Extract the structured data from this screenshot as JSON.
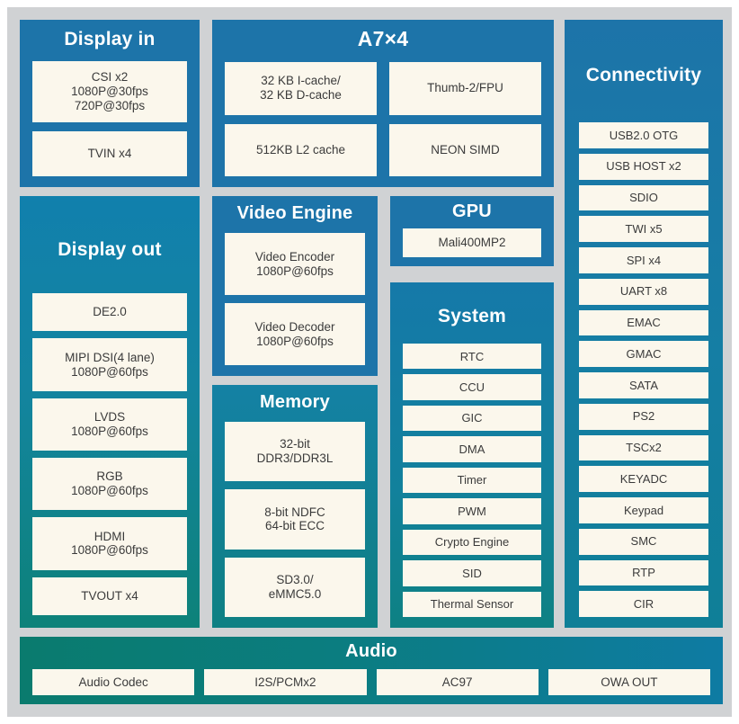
{
  "diagram": {
    "background_color": "#d0d2d4",
    "card_color": "#fbf7ec",
    "blue": "#1d74a9",
    "teal": "#0d8279",
    "green": "#0a7b6e"
  },
  "display_in": {
    "title": "Display in",
    "cards": [
      {
        "lines": [
          "CSI x2",
          "1080P@30fps",
          "720P@30fps"
        ]
      },
      {
        "lines": [
          "TVIN x4"
        ]
      }
    ]
  },
  "a7": {
    "title": "A7×4",
    "cards": [
      {
        "lines": [
          "32 KB I-cache/",
          "32 KB D-cache"
        ]
      },
      {
        "lines": [
          "Thumb-2/FPU"
        ]
      },
      {
        "lines": [
          "512KB L2 cache"
        ]
      },
      {
        "lines": [
          "NEON SIMD"
        ]
      }
    ]
  },
  "connectivity": {
    "title": "Connectivity",
    "cards": [
      {
        "lines": [
          "USB2.0 OTG"
        ]
      },
      {
        "lines": [
          "USB HOST x2"
        ]
      },
      {
        "lines": [
          "SDIO"
        ]
      },
      {
        "lines": [
          "TWI x5"
        ]
      },
      {
        "lines": [
          "SPI x4"
        ]
      },
      {
        "lines": [
          "UART x8"
        ]
      },
      {
        "lines": [
          "EMAC"
        ]
      },
      {
        "lines": [
          "GMAC"
        ]
      },
      {
        "lines": [
          "SATA"
        ]
      },
      {
        "lines": [
          "PS2"
        ]
      },
      {
        "lines": [
          "TSCx2"
        ]
      },
      {
        "lines": [
          "KEYADC"
        ]
      },
      {
        "lines": [
          "Keypad"
        ]
      },
      {
        "lines": [
          "SMC"
        ]
      },
      {
        "lines": [
          "RTP"
        ]
      },
      {
        "lines": [
          "CIR"
        ]
      }
    ]
  },
  "display_out": {
    "title": "Display out",
    "cards": [
      {
        "lines": [
          "DE2.0"
        ]
      },
      {
        "lines": [
          "MIPI DSI(4 lane)",
          "1080P@60fps"
        ]
      },
      {
        "lines": [
          "LVDS",
          "1080P@60fps"
        ]
      },
      {
        "lines": [
          "RGB",
          "1080P@60fps"
        ]
      },
      {
        "lines": [
          "HDMI",
          "1080P@60fps"
        ]
      },
      {
        "lines": [
          "TVOUT x4"
        ]
      }
    ]
  },
  "video_engine": {
    "title": "Video Engine",
    "cards": [
      {
        "lines": [
          "Video Encoder",
          "1080P@60fps"
        ]
      },
      {
        "lines": [
          "Video Decoder",
          "1080P@60fps"
        ]
      }
    ]
  },
  "memory": {
    "title": "Memory",
    "cards": [
      {
        "lines": [
          "32-bit",
          "DDR3/DDR3L"
        ]
      },
      {
        "lines": [
          "8-bit NDFC",
          "64-bit ECC"
        ]
      },
      {
        "lines": [
          "SD3.0/",
          "eMMC5.0"
        ]
      }
    ]
  },
  "gpu": {
    "title": "GPU",
    "cards": [
      {
        "lines": [
          "Mali400MP2"
        ]
      }
    ]
  },
  "system": {
    "title": "System",
    "cards": [
      {
        "lines": [
          "RTC"
        ]
      },
      {
        "lines": [
          "CCU"
        ]
      },
      {
        "lines": [
          "GIC"
        ]
      },
      {
        "lines": [
          "DMA"
        ]
      },
      {
        "lines": [
          "Timer"
        ]
      },
      {
        "lines": [
          "PWM"
        ]
      },
      {
        "lines": [
          "Crypto Engine"
        ]
      },
      {
        "lines": [
          "SID"
        ]
      },
      {
        "lines": [
          "Thermal Sensor"
        ]
      }
    ]
  },
  "audio": {
    "title": "Audio",
    "cards": [
      {
        "lines": [
          "Audio Codec"
        ]
      },
      {
        "lines": [
          "I2S/PCMx2"
        ]
      },
      {
        "lines": [
          "AC97"
        ]
      },
      {
        "lines": [
          "OWA OUT"
        ]
      }
    ]
  }
}
